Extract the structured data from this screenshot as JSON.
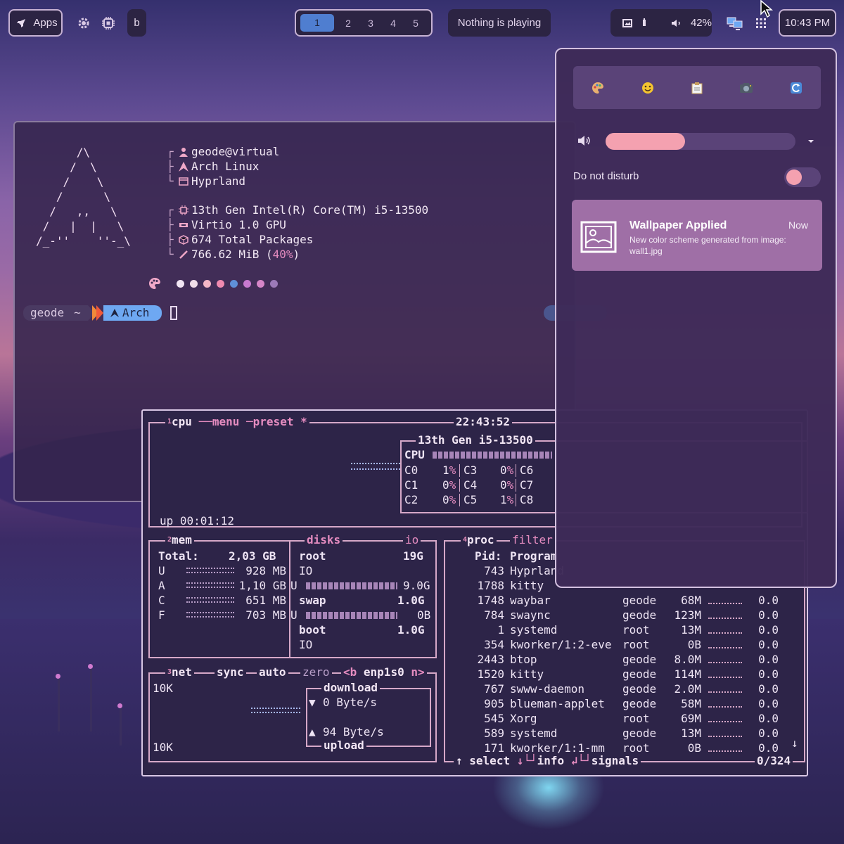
{
  "topbar": {
    "apps_label": "Apps",
    "user_initial": "b",
    "workspaces": [
      "1",
      "2",
      "3",
      "4",
      "5"
    ],
    "active_workspace": "1",
    "media": "Nothing is playing",
    "volume": "42%",
    "clock": "10:43 PM"
  },
  "fastfetch": {
    "ascii_logo": "      /\\\n     /  \\\n    /    \\\n   /      \\\n  /   ,,   \\\n /   |  |   \\\n/_-''    ''-_\\",
    "user_host": "geode@virtual",
    "os": "Arch Linux",
    "wm": "Hyprland",
    "cpu": "13th Gen Intel(R) Core(TM) i5-13500",
    "gpu": "Virtio 1.0 GPU",
    "packages": "674 Total Packages",
    "memory": "766.62 MiB (",
    "memory_pct": "40%",
    "memory_close": ")",
    "palette": [
      "#f2e6f4",
      "#f0dde8",
      "#f4b6c6",
      "#f08ab0",
      "#5f90d8",
      "#c87ad0",
      "#d686c8",
      "#9c7ab8"
    ]
  },
  "prompt": {
    "user": "geode",
    "dir": "~",
    "distro": "Arch"
  },
  "btop": {
    "cpu_box": {
      "tab_num": "1",
      "tabs": [
        "cpu",
        "menu",
        "preset *"
      ],
      "clock": "22:43:52",
      "model": "13th Gen i5-13500",
      "cpu_label": "CPU",
      "cores": [
        [
          "C0",
          "1%",
          "C3",
          "0%",
          "C6"
        ],
        [
          "C1",
          "0%",
          "C4",
          "0%",
          "C7"
        ],
        [
          "C2",
          "0%",
          "C5",
          "1%",
          "C8"
        ]
      ],
      "uptime": "up 00:01:12"
    },
    "mem_box": {
      "tab_num": "2",
      "title": "mem",
      "disks_label": "disks",
      "io_label": "io",
      "total_label": "Total:",
      "total_value": "2,03 GB",
      "rows": [
        {
          "key": "U",
          "value": "928 MB"
        },
        {
          "key": "A",
          "value": "1,10 GB"
        },
        {
          "key": "C",
          "value": "651 MB"
        },
        {
          "key": "F",
          "value": "703 MB"
        }
      ],
      "disks": [
        {
          "name": "root",
          "size": "19G",
          "io": "IO",
          "used_label": "U",
          "used": "9.0G"
        },
        {
          "name": "swap",
          "size": "1.0G",
          "used_label": "U",
          "used": "0B"
        },
        {
          "name": "boot",
          "size": "1.0G",
          "io": "IO"
        }
      ]
    },
    "net_box": {
      "tab_num": "3",
      "title": "net",
      "options": [
        "sync",
        "auto",
        "zero"
      ],
      "iface_prev": "<b",
      "iface": "enp1s0",
      "iface_next": "n>",
      "scale_top": "10K",
      "scale_bottom": "10K",
      "download_label": "download",
      "download_value": "0 Byte/s",
      "upload_label": "upload",
      "upload_value": "94 Byte/s"
    },
    "proc_box": {
      "tab_num": "4",
      "title": "proc",
      "filter_label": "filter",
      "header_pid": "Pid:",
      "header_program": "Program",
      "rows": [
        {
          "pid": "743",
          "name": "Hyprland",
          "user": "",
          "mem": "",
          "cpu": ""
        },
        {
          "pid": "1788",
          "name": "kitty",
          "user": "",
          "mem": "",
          "cpu": ""
        },
        {
          "pid": "1748",
          "name": "waybar",
          "user": "geode",
          "mem": "68M",
          "cpu": "0.0"
        },
        {
          "pid": "784",
          "name": "swaync",
          "user": "geode",
          "mem": "123M",
          "cpu": "0.0"
        },
        {
          "pid": "1",
          "name": "systemd",
          "user": "root",
          "mem": "13M",
          "cpu": "0.0"
        },
        {
          "pid": "354",
          "name": "kworker/1:2-eve",
          "user": "root",
          "mem": "0B",
          "cpu": "0.0"
        },
        {
          "pid": "2443",
          "name": "btop",
          "user": "geode",
          "mem": "8.0M",
          "cpu": "0.0"
        },
        {
          "pid": "1520",
          "name": "kitty",
          "user": "geode",
          "mem": "114M",
          "cpu": "0.0"
        },
        {
          "pid": "767",
          "name": "swww-daemon",
          "user": "geode",
          "mem": "2.0M",
          "cpu": "0.0"
        },
        {
          "pid": "905",
          "name": "blueman-applet",
          "user": "geode",
          "mem": "58M",
          "cpu": "0.0"
        },
        {
          "pid": "545",
          "name": "Xorg",
          "user": "root",
          "mem": "69M",
          "cpu": "0.0"
        },
        {
          "pid": "589",
          "name": "systemd",
          "user": "geode",
          "mem": "13M",
          "cpu": "0.0"
        },
        {
          "pid": "171",
          "name": "kworker/1:1-mm_",
          "user": "root",
          "mem": "0B",
          "cpu": "0.0"
        }
      ],
      "footer_select": "select",
      "footer_info": "info",
      "footer_signals": "signals",
      "count": "0/324"
    }
  },
  "panel": {
    "quick_buttons": [
      "palette-icon",
      "emoji-icon",
      "clipboard-icon",
      "screenshot-icon",
      "refresh-icon"
    ],
    "volume_level": 0.42,
    "dnd_label": "Do not disturb",
    "dnd_on": false,
    "notification": {
      "title": "Wallpaper Applied",
      "time": "Now",
      "body": "New color scheme generated from image:",
      "file": "wall1.jpg"
    }
  },
  "colors": {
    "accent": "#4f7ed0",
    "pink": "#f4a1b0",
    "panel_bg": "#3e2a58",
    "btop_border": "#d6a8c8"
  }
}
